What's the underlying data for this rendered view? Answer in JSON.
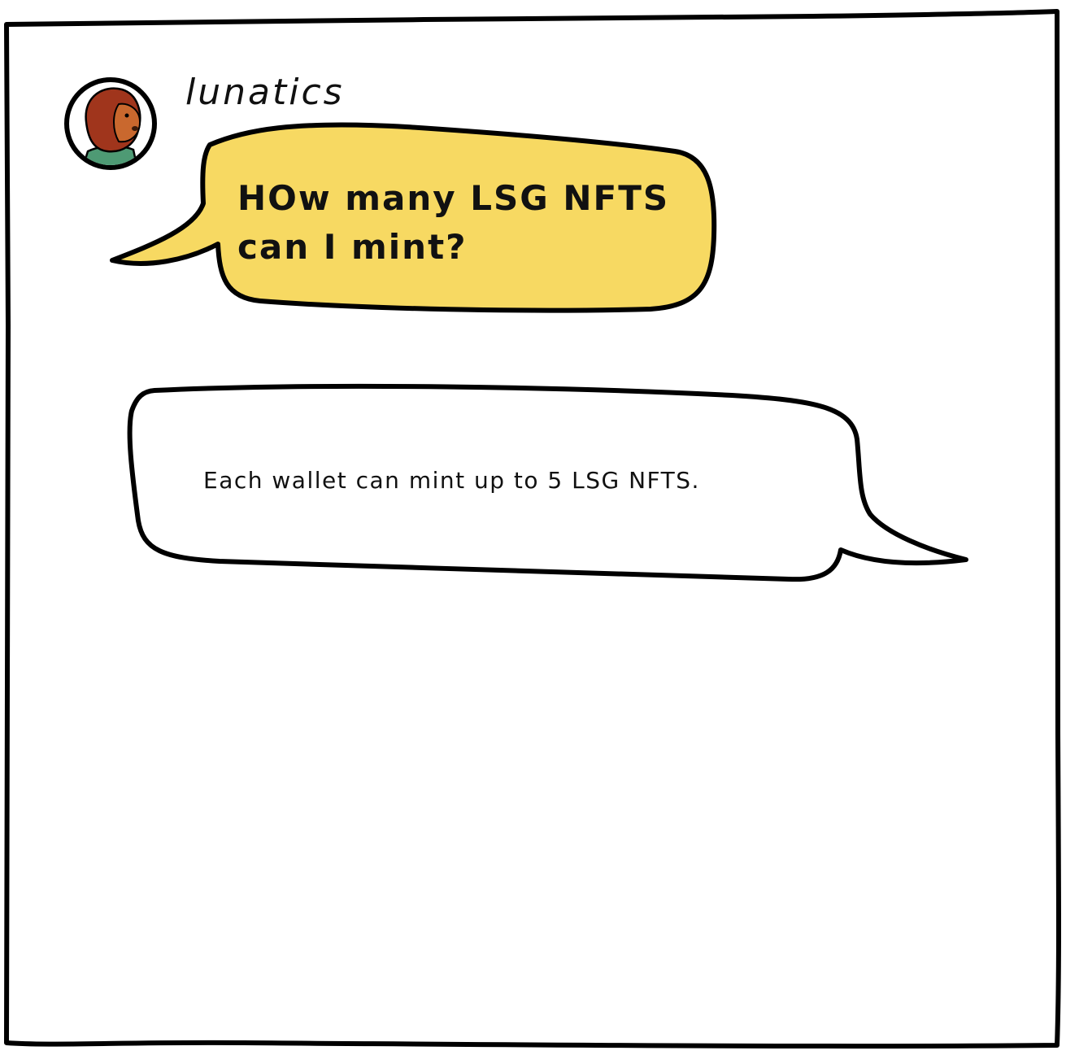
{
  "colors": {
    "background": "#ffffff",
    "outline": "#000000",
    "question_bubble_fill": "#f7d962",
    "answer_bubble_fill": "#ffffff",
    "avatar_fur": "#a0351c",
    "avatar_face": "#c9682e",
    "avatar_shirt": "#4e9a74"
  },
  "user": {
    "name": "lunatics",
    "avatar_icon": "monkey-avatar-icon"
  },
  "question": {
    "line1": "HOw many LSG NFTS",
    "line2": "can I mint?"
  },
  "answer": {
    "text": "Each wallet can mint up to 5 LSG NFTS."
  }
}
